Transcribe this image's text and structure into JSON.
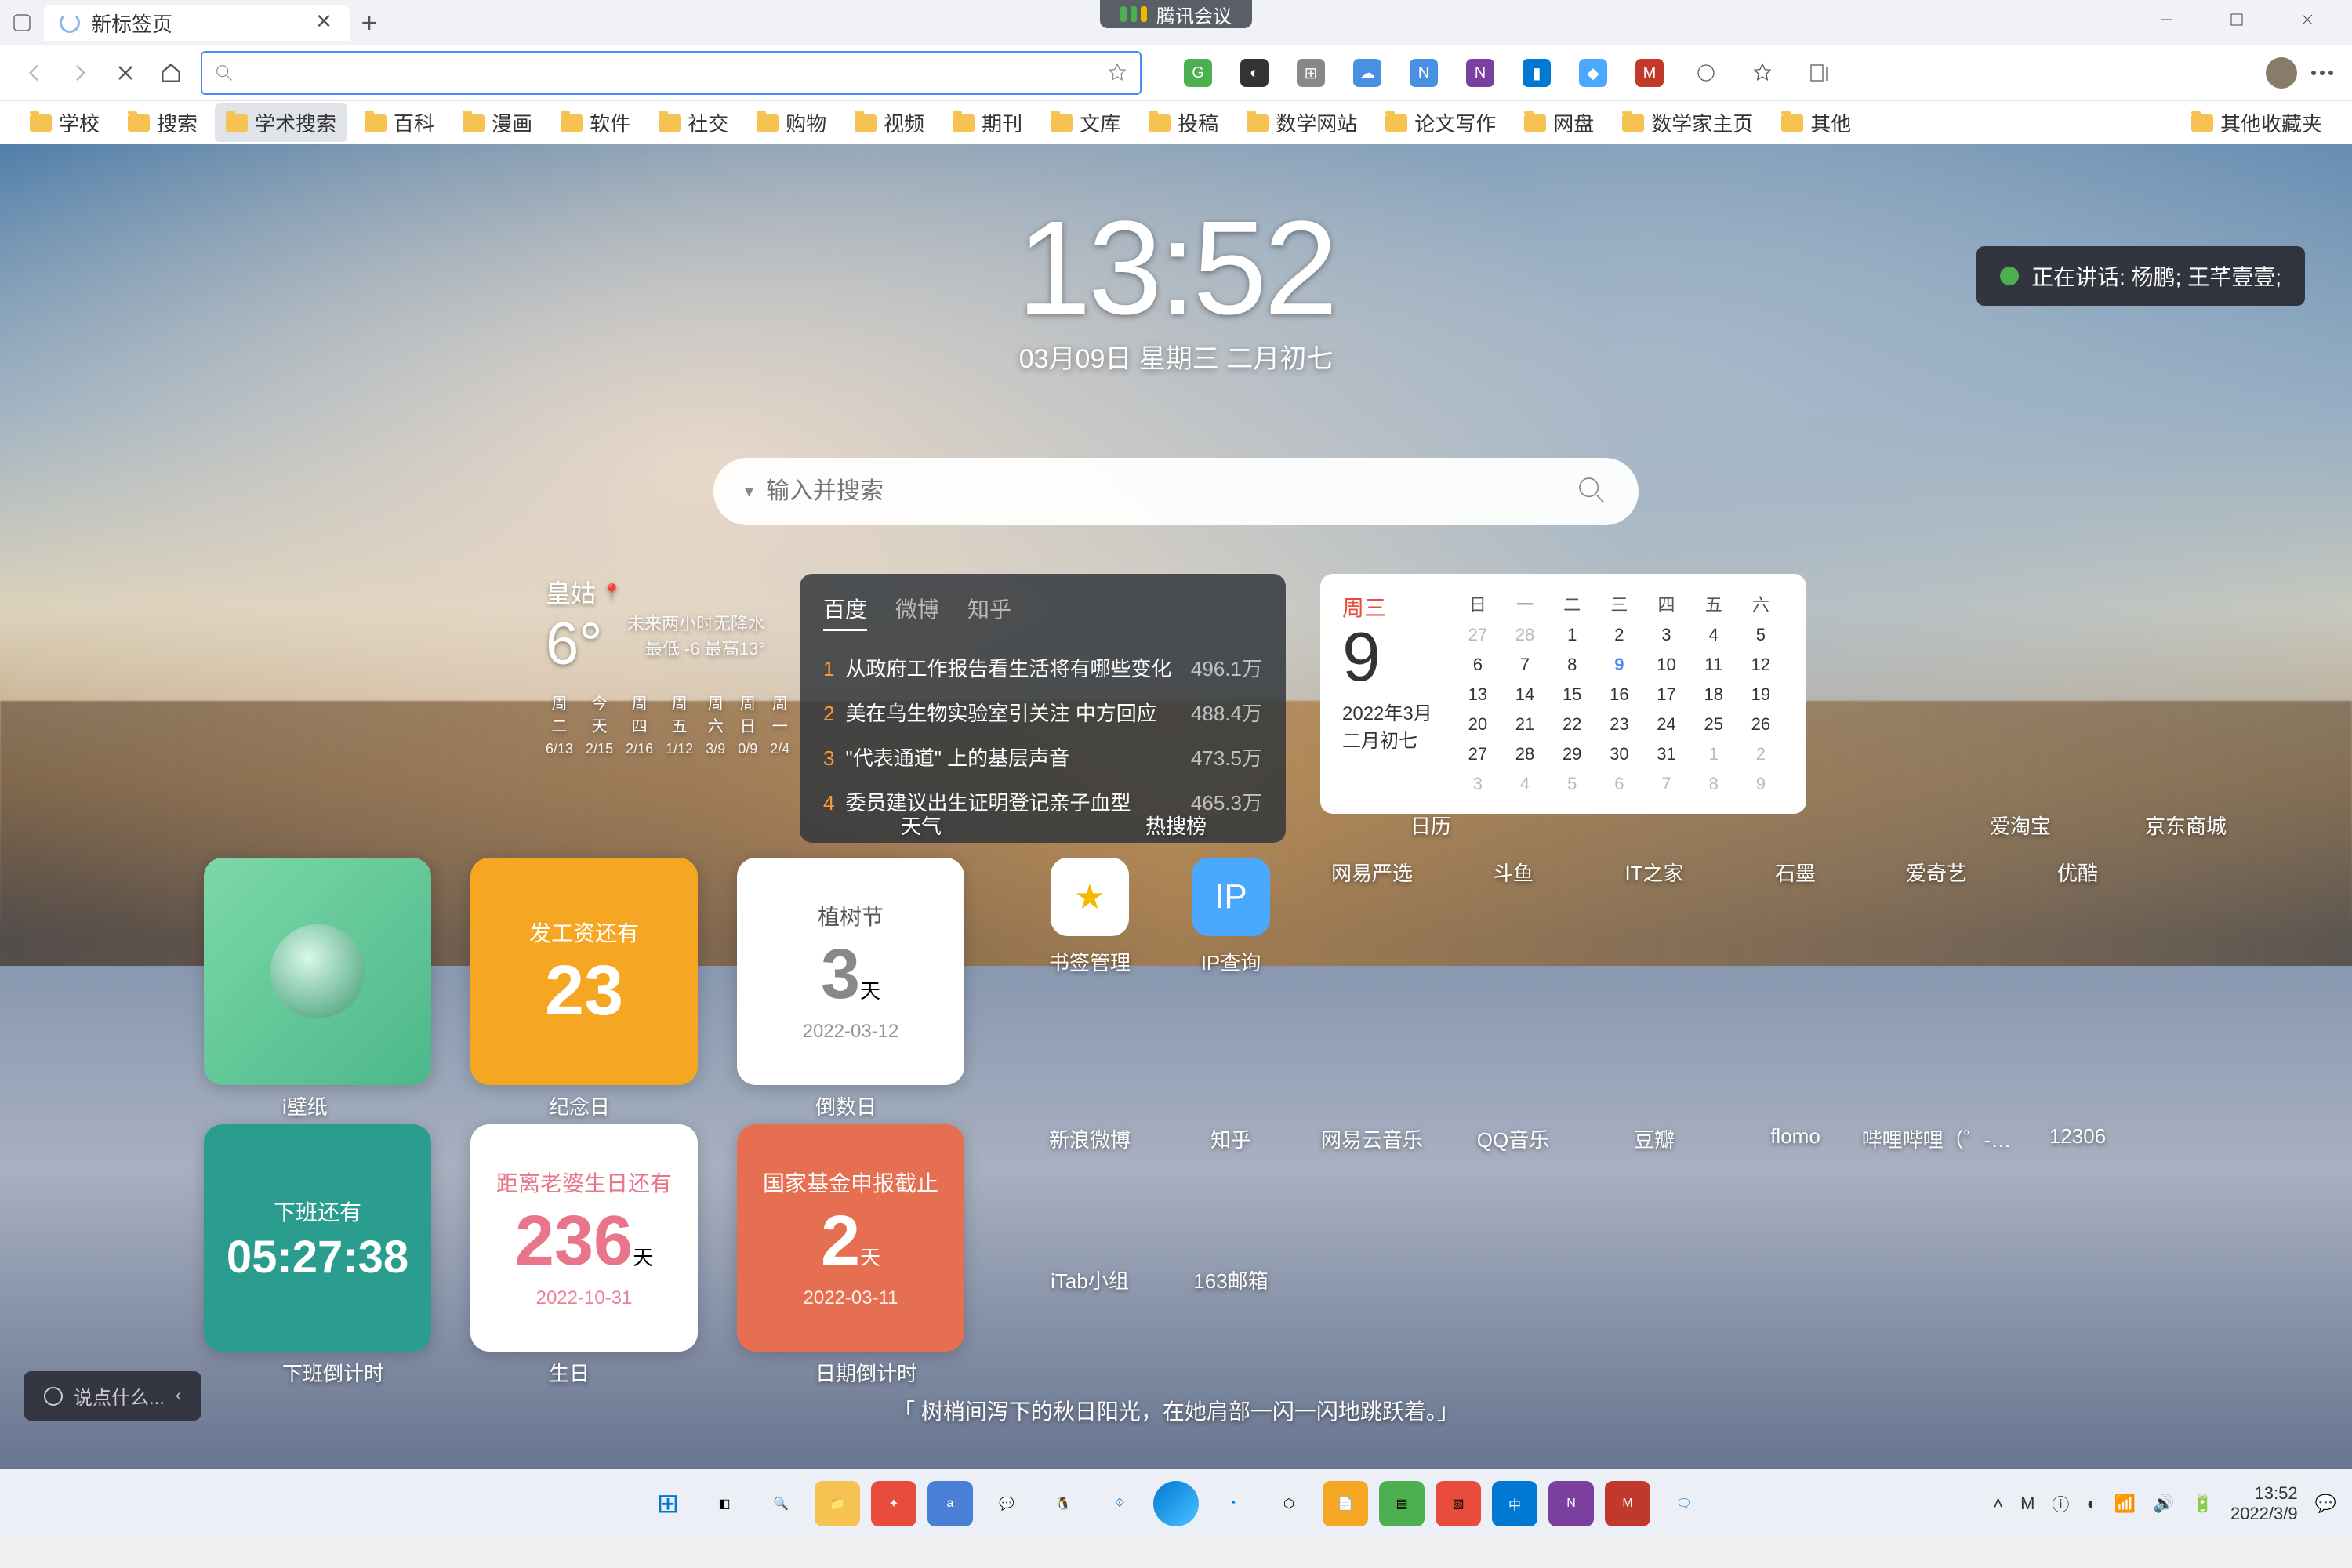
{
  "titlebar": {
    "tab_title": "新标签页",
    "meeting": "腾讯会议"
  },
  "toolbar": {
    "url_value": "",
    "url_placeholder": ""
  },
  "bookmarks": [
    "学校",
    "搜索",
    "学术搜索",
    "百科",
    "漫画",
    "软件",
    "社交",
    "购物",
    "视频",
    "期刊",
    "文库",
    "投稿",
    "数学网站",
    "论文写作",
    "网盘",
    "数学家主页",
    "其他"
  ],
  "bookmarks_overflow": "其他收藏夹",
  "ntp": {
    "clock": {
      "time": "13:52",
      "date": "03月09日  星期三  二月初七"
    },
    "speaking": "正在讲话: 杨鹏; 王芊壹壹;",
    "search_placeholder": "输入并搜索",
    "weather": {
      "location": "皇姑",
      "temp": "6°",
      "line1": "未来两小时无降水",
      "line2": "最低 -6   最高13°",
      "days": [
        {
          "d": "周二",
          "v": "6/13"
        },
        {
          "d": "今天",
          "v": "2/15"
        },
        {
          "d": "周四",
          "v": "2/16"
        },
        {
          "d": "周五",
          "v": "1/12"
        },
        {
          "d": "周六",
          "v": "3/9"
        },
        {
          "d": "周日",
          "v": "0/9"
        },
        {
          "d": "周一",
          "v": "2/4"
        }
      ]
    },
    "hot": {
      "tabs": [
        "百度",
        "微博",
        "知乎"
      ],
      "rows": [
        {
          "n": "1",
          "t": "从政府工作报告看生活将有哪些变化",
          "c": "496.1万"
        },
        {
          "n": "2",
          "t": "美在乌生物实验室引关注 中方回应",
          "c": "488.4万"
        },
        {
          "n": "3",
          "t": "\"代表通道\" 上的基层声音",
          "c": "473.5万"
        },
        {
          "n": "4",
          "t": "委员建议出生证明登记亲子血型",
          "c": "465.3万"
        }
      ]
    },
    "cal": {
      "weekday": "周三",
      "day": "9",
      "monthyear": "2022年3月",
      "lunar": "二月初七",
      "hdr": [
        "日",
        "一",
        "二",
        "三",
        "四",
        "五",
        "六"
      ],
      "cells": [
        {
          "v": "27",
          "dim": true
        },
        {
          "v": "28",
          "dim": true
        },
        {
          "v": "1"
        },
        {
          "v": "2"
        },
        {
          "v": "3"
        },
        {
          "v": "4"
        },
        {
          "v": "5"
        },
        {
          "v": "6"
        },
        {
          "v": "7"
        },
        {
          "v": "8"
        },
        {
          "v": "9",
          "today": true
        },
        {
          "v": "10"
        },
        {
          "v": "11"
        },
        {
          "v": "12"
        },
        {
          "v": "13"
        },
        {
          "v": "14"
        },
        {
          "v": "15"
        },
        {
          "v": "16"
        },
        {
          "v": "17"
        },
        {
          "v": "18"
        },
        {
          "v": "19"
        },
        {
          "v": "20"
        },
        {
          "v": "21"
        },
        {
          "v": "22"
        },
        {
          "v": "23"
        },
        {
          "v": "24"
        },
        {
          "v": "25"
        },
        {
          "v": "26"
        },
        {
          "v": "27"
        },
        {
          "v": "28"
        },
        {
          "v": "29"
        },
        {
          "v": "30"
        },
        {
          "v": "31"
        },
        {
          "v": "1",
          "dim": true
        },
        {
          "v": "2",
          "dim": true
        },
        {
          "v": "3",
          "dim": true
        },
        {
          "v": "4",
          "dim": true
        },
        {
          "v": "5",
          "dim": true
        },
        {
          "v": "6",
          "dim": true
        },
        {
          "v": "7",
          "dim": true
        },
        {
          "v": "8",
          "dim": true
        },
        {
          "v": "9",
          "dim": true
        }
      ]
    },
    "widlabels": [
      "天气",
      "热搜榜",
      "日历"
    ],
    "extlabels": [
      "爱淘宝",
      "京东商城"
    ],
    "cards": [
      {
        "cls": "green",
        "t": "",
        "big": "",
        "sm": "",
        "dt": "",
        "label": "i壁纸"
      },
      {
        "cls": "orange",
        "t": "发工资还有",
        "big": "23",
        "sm": "",
        "dt": "",
        "label": "纪念日"
      },
      {
        "cls": "white",
        "t": "植树节",
        "big": "3",
        "sm": "天",
        "dt": "2022-03-12",
        "label": "倒数日"
      },
      {
        "cls": "teal",
        "t": "下班还有",
        "big": "05:27:38",
        "sm": "",
        "dt": "",
        "label": "下班倒计时"
      },
      {
        "cls": "pink",
        "t": "距离老婆生日还有",
        "big": "236",
        "sm": "天",
        "dt": "2022-10-31",
        "label": "生日"
      },
      {
        "cls": "red",
        "t": "国家基金申报截止",
        "big": "2",
        "sm": "天",
        "dt": "2022-03-11",
        "label": "日期倒计时"
      }
    ],
    "apps_row1": [
      {
        "lbl": "书签管理",
        "bg": "#fff",
        "fg": "#f5b800",
        "sym": "★"
      },
      {
        "lbl": "IP查询",
        "bg": "#4aa8ff",
        "fg": "#fff",
        "sym": "IP"
      },
      {
        "lbl": "网易严选",
        "bg": "",
        "fg": "",
        "sym": ""
      },
      {
        "lbl": "斗鱼",
        "bg": "",
        "fg": "",
        "sym": ""
      },
      {
        "lbl": "IT之家",
        "bg": "",
        "fg": "",
        "sym": ""
      },
      {
        "lbl": "石墨",
        "bg": "",
        "fg": "",
        "sym": ""
      },
      {
        "lbl": "爱奇艺",
        "bg": "",
        "fg": "",
        "sym": ""
      },
      {
        "lbl": "优酷",
        "bg": "",
        "fg": "",
        "sym": ""
      }
    ],
    "apps_row2": [
      {
        "lbl": "新浪微博"
      },
      {
        "lbl": "知乎"
      },
      {
        "lbl": "网易云音乐"
      },
      {
        "lbl": "QQ音乐"
      },
      {
        "lbl": "豆瓣"
      },
      {
        "lbl": "flomo"
      },
      {
        "lbl": "哔哩哔哩（゜-…"
      },
      {
        "lbl": "12306"
      }
    ],
    "apps_row3": [
      {
        "lbl": "iTab小组"
      },
      {
        "lbl": "163邮箱"
      }
    ],
    "quote": "「 树梢间泻下的秋日阳光，在她肩部一闪一闪地跳跃着。」",
    "feedback": "说点什么..."
  },
  "taskbar": {
    "time": "13:52",
    "date": "2022/3/9"
  }
}
